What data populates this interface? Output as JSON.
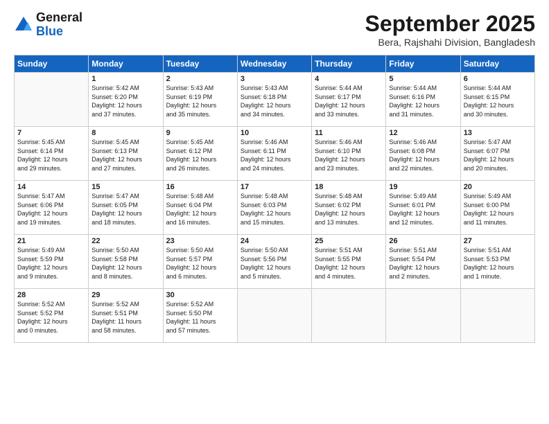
{
  "header": {
    "logo_line1": "General",
    "logo_line2": "Blue",
    "month": "September 2025",
    "location": "Bera, Rajshahi Division, Bangladesh"
  },
  "weekdays": [
    "Sunday",
    "Monday",
    "Tuesday",
    "Wednesday",
    "Thursday",
    "Friday",
    "Saturday"
  ],
  "weeks": [
    [
      {
        "day": "",
        "info": ""
      },
      {
        "day": "1",
        "info": "Sunrise: 5:42 AM\nSunset: 6:20 PM\nDaylight: 12 hours\nand 37 minutes."
      },
      {
        "day": "2",
        "info": "Sunrise: 5:43 AM\nSunset: 6:19 PM\nDaylight: 12 hours\nand 35 minutes."
      },
      {
        "day": "3",
        "info": "Sunrise: 5:43 AM\nSunset: 6:18 PM\nDaylight: 12 hours\nand 34 minutes."
      },
      {
        "day": "4",
        "info": "Sunrise: 5:44 AM\nSunset: 6:17 PM\nDaylight: 12 hours\nand 33 minutes."
      },
      {
        "day": "5",
        "info": "Sunrise: 5:44 AM\nSunset: 6:16 PM\nDaylight: 12 hours\nand 31 minutes."
      },
      {
        "day": "6",
        "info": "Sunrise: 5:44 AM\nSunset: 6:15 PM\nDaylight: 12 hours\nand 30 minutes."
      }
    ],
    [
      {
        "day": "7",
        "info": "Sunrise: 5:45 AM\nSunset: 6:14 PM\nDaylight: 12 hours\nand 29 minutes."
      },
      {
        "day": "8",
        "info": "Sunrise: 5:45 AM\nSunset: 6:13 PM\nDaylight: 12 hours\nand 27 minutes."
      },
      {
        "day": "9",
        "info": "Sunrise: 5:45 AM\nSunset: 6:12 PM\nDaylight: 12 hours\nand 26 minutes."
      },
      {
        "day": "10",
        "info": "Sunrise: 5:46 AM\nSunset: 6:11 PM\nDaylight: 12 hours\nand 24 minutes."
      },
      {
        "day": "11",
        "info": "Sunrise: 5:46 AM\nSunset: 6:10 PM\nDaylight: 12 hours\nand 23 minutes."
      },
      {
        "day": "12",
        "info": "Sunrise: 5:46 AM\nSunset: 6:08 PM\nDaylight: 12 hours\nand 22 minutes."
      },
      {
        "day": "13",
        "info": "Sunrise: 5:47 AM\nSunset: 6:07 PM\nDaylight: 12 hours\nand 20 minutes."
      }
    ],
    [
      {
        "day": "14",
        "info": "Sunrise: 5:47 AM\nSunset: 6:06 PM\nDaylight: 12 hours\nand 19 minutes."
      },
      {
        "day": "15",
        "info": "Sunrise: 5:47 AM\nSunset: 6:05 PM\nDaylight: 12 hours\nand 18 minutes."
      },
      {
        "day": "16",
        "info": "Sunrise: 5:48 AM\nSunset: 6:04 PM\nDaylight: 12 hours\nand 16 minutes."
      },
      {
        "day": "17",
        "info": "Sunrise: 5:48 AM\nSunset: 6:03 PM\nDaylight: 12 hours\nand 15 minutes."
      },
      {
        "day": "18",
        "info": "Sunrise: 5:48 AM\nSunset: 6:02 PM\nDaylight: 12 hours\nand 13 minutes."
      },
      {
        "day": "19",
        "info": "Sunrise: 5:49 AM\nSunset: 6:01 PM\nDaylight: 12 hours\nand 12 minutes."
      },
      {
        "day": "20",
        "info": "Sunrise: 5:49 AM\nSunset: 6:00 PM\nDaylight: 12 hours\nand 11 minutes."
      }
    ],
    [
      {
        "day": "21",
        "info": "Sunrise: 5:49 AM\nSunset: 5:59 PM\nDaylight: 12 hours\nand 9 minutes."
      },
      {
        "day": "22",
        "info": "Sunrise: 5:50 AM\nSunset: 5:58 PM\nDaylight: 12 hours\nand 8 minutes."
      },
      {
        "day": "23",
        "info": "Sunrise: 5:50 AM\nSunset: 5:57 PM\nDaylight: 12 hours\nand 6 minutes."
      },
      {
        "day": "24",
        "info": "Sunrise: 5:50 AM\nSunset: 5:56 PM\nDaylight: 12 hours\nand 5 minutes."
      },
      {
        "day": "25",
        "info": "Sunrise: 5:51 AM\nSunset: 5:55 PM\nDaylight: 12 hours\nand 4 minutes."
      },
      {
        "day": "26",
        "info": "Sunrise: 5:51 AM\nSunset: 5:54 PM\nDaylight: 12 hours\nand 2 minutes."
      },
      {
        "day": "27",
        "info": "Sunrise: 5:51 AM\nSunset: 5:53 PM\nDaylight: 12 hours\nand 1 minute."
      }
    ],
    [
      {
        "day": "28",
        "info": "Sunrise: 5:52 AM\nSunset: 5:52 PM\nDaylight: 12 hours\nand 0 minutes."
      },
      {
        "day": "29",
        "info": "Sunrise: 5:52 AM\nSunset: 5:51 PM\nDaylight: 11 hours\nand 58 minutes."
      },
      {
        "day": "30",
        "info": "Sunrise: 5:52 AM\nSunset: 5:50 PM\nDaylight: 11 hours\nand 57 minutes."
      },
      {
        "day": "",
        "info": ""
      },
      {
        "day": "",
        "info": ""
      },
      {
        "day": "",
        "info": ""
      },
      {
        "day": "",
        "info": ""
      }
    ]
  ]
}
